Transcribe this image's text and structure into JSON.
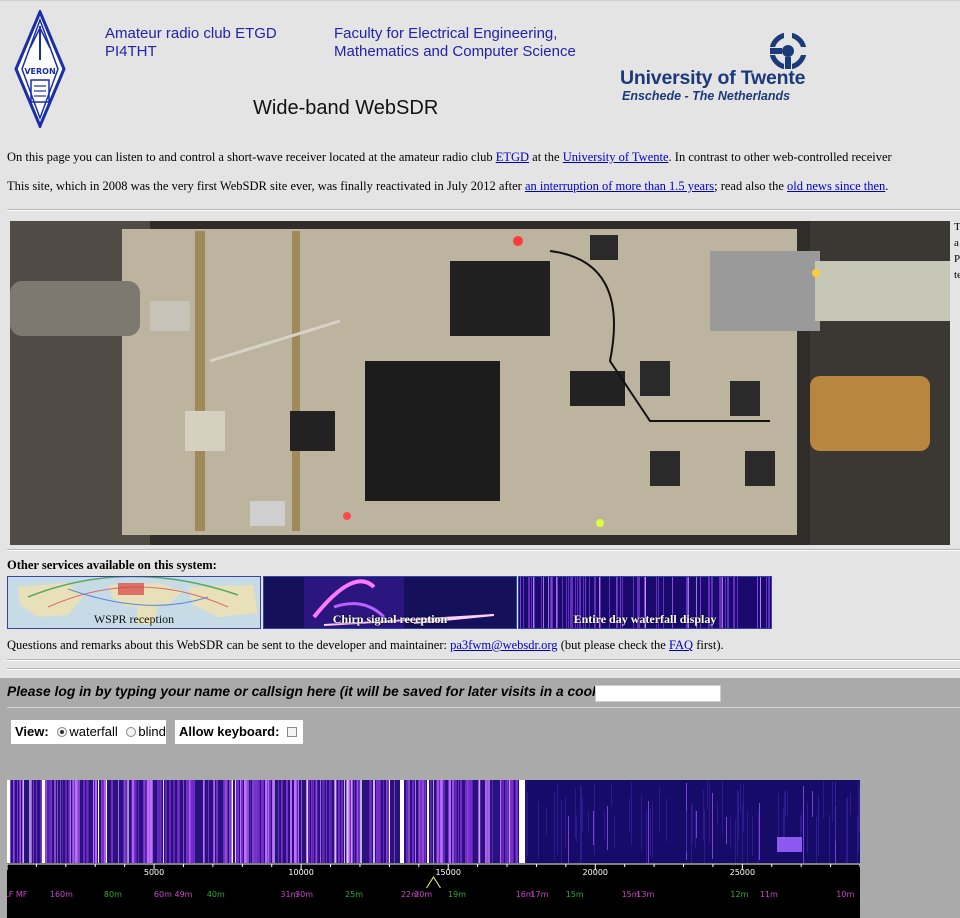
{
  "header": {
    "club_line1": "Amateur radio club ETGD",
    "club_line2": "PI4THT",
    "faculty_line1": "Faculty for Electrical Engineering,",
    "faculty_line2": "Mathematics and Computer Science",
    "site_title": "Wide-band WebSDR",
    "university_name": "University of Twente",
    "university_sub": "Enschede - The Netherlands",
    "veron_logo_text": "VERON"
  },
  "intro": {
    "p1_a": "On this page you can listen to and control a short-wave receiver located at the amateur radio club ",
    "p1_link1": "ETGD",
    "p1_b": " at the ",
    "p1_link2": "University of Twente",
    "p1_c": ". In contrast to other web-controlled receiver",
    "p2_a": "This site, which in 2008 was the very first WebSDR site ever, was finally reactivated in July 2012 after ",
    "p2_link1": "an interruption of more than 1.5 years",
    "p2_b": "; read also the ",
    "p2_link2": "old news since then",
    "p2_c": "."
  },
  "side_text": [
    "T",
    "a",
    "P",
    "te"
  ],
  "services": {
    "heading": "Other services available on this system:",
    "items": [
      {
        "label": "WSPR reception"
      },
      {
        "label": "Chirp signal reception"
      },
      {
        "label": "Entire day waterfall display"
      }
    ]
  },
  "contact": {
    "text_a": "Questions and remarks about this WebSDR can be sent to the developer and maintainer: ",
    "email": "pa3fwm@websdr.org",
    "text_b": " (but please check the ",
    "faq": "FAQ",
    "text_c": " first)."
  },
  "login": {
    "label": "Please log in by typing your name or callsign here (it will be saved for later visits in a cookie):",
    "value": ""
  },
  "view_controls": {
    "label": "View:",
    "options": [
      "waterfall",
      "blind"
    ],
    "selected": "waterfall"
  },
  "keyboard": {
    "label": "Allow keyboard:",
    "checked": false
  },
  "frequency_scale": {
    "range_khz": [
      0,
      29000
    ],
    "ticks": [
      "5000",
      "10000",
      "15000",
      "20000",
      "25000"
    ],
    "tuned_khz": 14500,
    "bands": [
      {
        "label": "LF MF",
        "khz": 300
      },
      {
        "label": "160m",
        "khz": 1850
      },
      {
        "label": "80m",
        "khz": 3600
      },
      {
        "label": "60m",
        "khz": 5300
      },
      {
        "label": "49m",
        "khz": 6000
      },
      {
        "label": "40m",
        "khz": 7100
      },
      {
        "label": "31m",
        "khz": 9600
      },
      {
        "label": "30m",
        "khz": 10100
      },
      {
        "label": "25m",
        "khz": 11800
      },
      {
        "label": "22m",
        "khz": 13700
      },
      {
        "label": "20m",
        "khz": 14150
      },
      {
        "label": "19m",
        "khz": 15300
      },
      {
        "label": "16m",
        "khz": 17600
      },
      {
        "label": "17m",
        "khz": 18100
      },
      {
        "label": "15m",
        "khz": 19300
      },
      {
        "label": "15m",
        "khz": 21200
      },
      {
        "label": "13m",
        "khz": 21700
      },
      {
        "label": "12m",
        "khz": 24900
      },
      {
        "label": "11m",
        "khz": 25900
      },
      {
        "label": "10m",
        "khz": 28500
      }
    ]
  },
  "colors": {
    "link": "#0000cc",
    "header_text": "#2222aa",
    "university": "#1b3a7a",
    "control_bg": "#aaaaaa",
    "waterfall_low": "#1a0a6e",
    "waterfall_mid": "#7a2fd0",
    "waterfall_high": "#ffffff",
    "band_label": "#cc44cc",
    "band_label_alt": "#33aa33"
  }
}
